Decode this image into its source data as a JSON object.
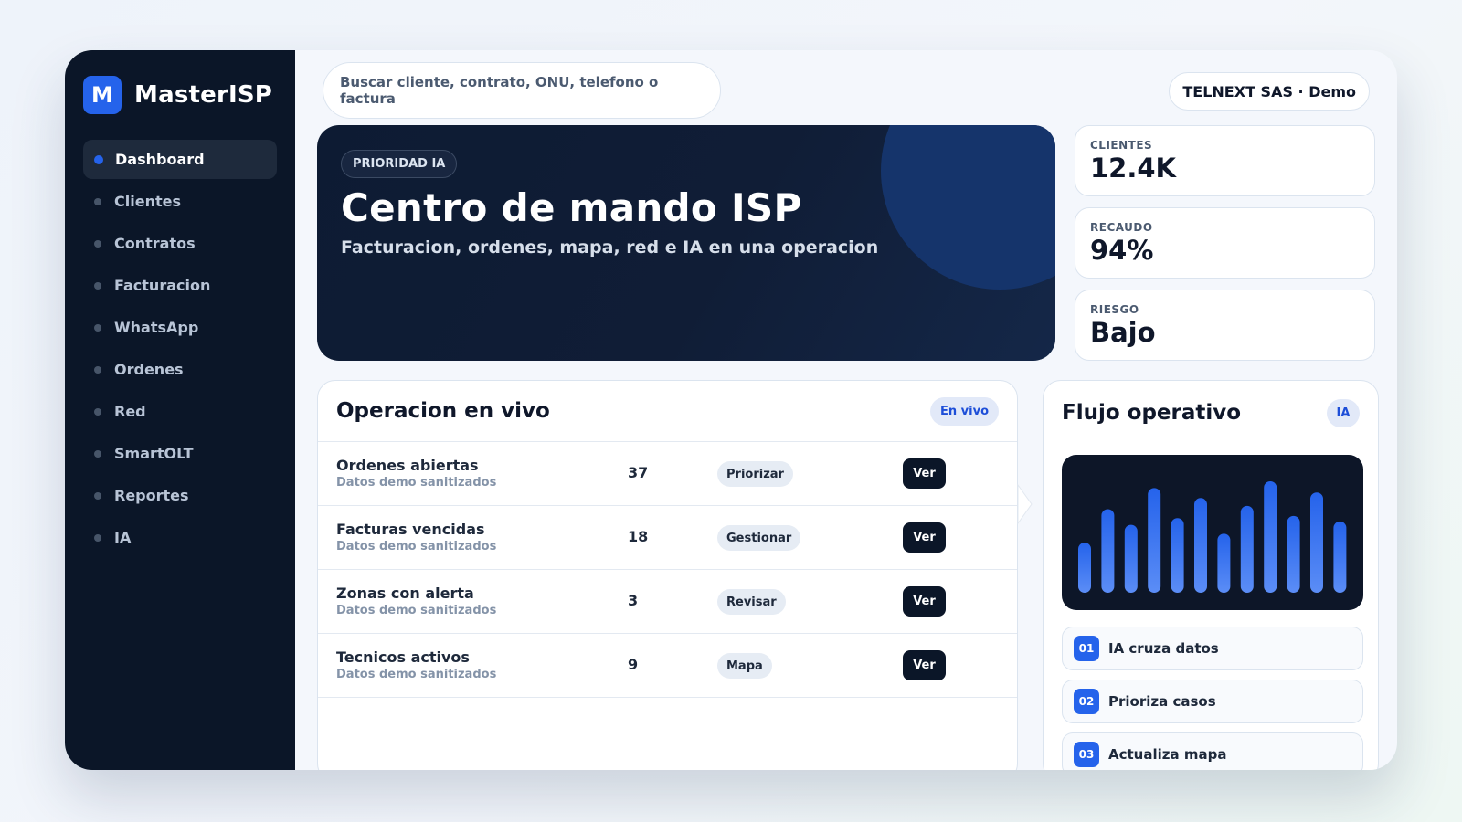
{
  "brand": {
    "logo_letter": "M",
    "name": "MasterISP"
  },
  "sidebar": {
    "items": [
      {
        "label": "Dashboard",
        "active": true
      },
      {
        "label": "Clientes",
        "active": false
      },
      {
        "label": "Contratos",
        "active": false
      },
      {
        "label": "Facturacion",
        "active": false
      },
      {
        "label": "WhatsApp",
        "active": false
      },
      {
        "label": "Ordenes",
        "active": false
      },
      {
        "label": "Red",
        "active": false
      },
      {
        "label": "SmartOLT",
        "active": false
      },
      {
        "label": "Reportes",
        "active": false
      },
      {
        "label": "IA",
        "active": false
      }
    ]
  },
  "header": {
    "search_placeholder": "Buscar cliente, contrato, ONU, telefono o factura",
    "company": "TELNEXT SAS · Demo"
  },
  "hero": {
    "badge": "PRIORIDAD IA",
    "title": "Centro de mando ISP",
    "subtitle": "Facturacion, ordenes, mapa, red e IA en una operacion"
  },
  "stats": [
    {
      "label": "CLIENTES",
      "value": "12.4K"
    },
    {
      "label": "RECAUDO",
      "value": "94%"
    },
    {
      "label": "RIESGO",
      "value": "Bajo"
    }
  ],
  "operacion": {
    "title": "Operacion en vivo",
    "badge": "En vivo",
    "rows": [
      {
        "title": "Ordenes abiertas",
        "subtitle": "Datos demo sanitizados",
        "count": "37",
        "action": "Priorizar",
        "view": "Ver"
      },
      {
        "title": "Facturas vencidas",
        "subtitle": "Datos demo sanitizados",
        "count": "18",
        "action": "Gestionar",
        "view": "Ver"
      },
      {
        "title": "Zonas con alerta",
        "subtitle": "Datos demo sanitizados",
        "count": "3",
        "action": "Revisar",
        "view": "Ver"
      },
      {
        "title": "Tecnicos activos",
        "subtitle": "Datos demo sanitizados",
        "count": "9",
        "action": "Mapa",
        "view": "Ver"
      }
    ]
  },
  "flujo": {
    "title": "Flujo operativo",
    "badge": "IA",
    "chart_levels": [
      0.45,
      0.75,
      0.61,
      0.94,
      0.67,
      0.85,
      0.53,
      0.78,
      1.0,
      0.69,
      0.9,
      0.64
    ],
    "bar_color_top": "#2563eb",
    "bar_color_bottom": "#5b8df6",
    "steps": [
      {
        "num": "01",
        "label": "IA cruza datos"
      },
      {
        "num": "02",
        "label": "Prioriza casos"
      },
      {
        "num": "03",
        "label": "Actualiza mapa"
      }
    ]
  }
}
